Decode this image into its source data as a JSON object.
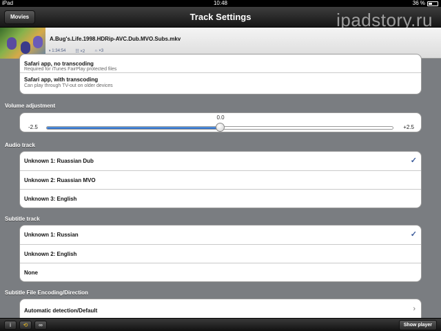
{
  "statusbar": {
    "device": "iPad",
    "time": "10:48",
    "battery": "36 %"
  },
  "navbar": {
    "back_label": "Movies",
    "title": "Track Settings",
    "watermark": "ipadstory.ru"
  },
  "file": {
    "name": "A.Bug's.Life.1998.HDRip-AVC.Dub.MVO.Subs.mkv",
    "duration": "1:34:54",
    "subs_count": "×2",
    "audio_count": "×3"
  },
  "output": [
    {
      "label": "Safari app, no transcoding",
      "sub": "Required for iTunes FairPlay protected files"
    },
    {
      "label": "Safari app, with transcoding",
      "sub": "Can play through TV-out on older devices"
    }
  ],
  "volume": {
    "label": "Volume adjustment",
    "value": "0.0",
    "min": "-2.5",
    "max": "+2.5",
    "fraction": 0.5
  },
  "audio": {
    "label": "Audio track",
    "items": [
      {
        "label": "Unknown 1: Ruassian Dub",
        "check": "✓"
      },
      {
        "label": "Unknown 2: Ruassian MVO",
        "check": ""
      },
      {
        "label": "Unknown 3: English",
        "check": ""
      }
    ]
  },
  "subtitle": {
    "label": "Subtitle track",
    "items": [
      {
        "label": "Unknown 1: Russian",
        "check": "✓"
      },
      {
        "label": "Unknown 2: English",
        "check": ""
      },
      {
        "label": "None",
        "check": ""
      }
    ]
  },
  "encoding": {
    "label": "Subtitle File Encoding/Direction",
    "item": "Automatic detection/Default",
    "chevron": "›"
  },
  "toolbar": {
    "show_player": "Show player"
  },
  "colors": {
    "accent": "#2a66c4",
    "check": "#3a5a9a",
    "background": "#7a7d81"
  }
}
